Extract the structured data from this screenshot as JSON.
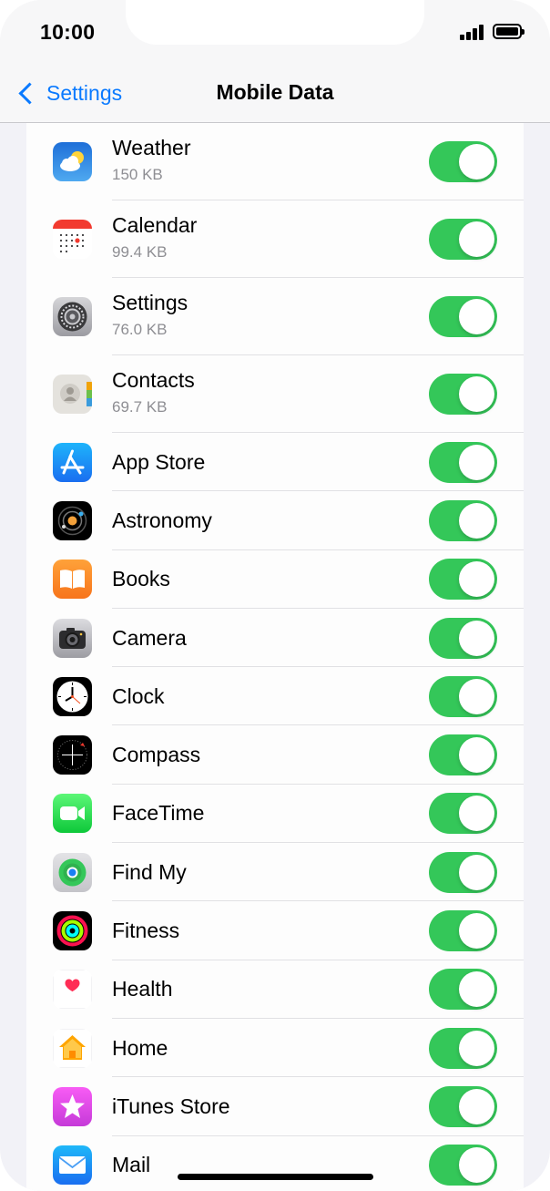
{
  "status_bar": {
    "time": "10:00"
  },
  "nav": {
    "back_label": "Settings",
    "title": "Mobile Data"
  },
  "apps": [
    {
      "name": "Weather",
      "size": "150 KB",
      "icon": "weather-icon",
      "enabled": true
    },
    {
      "name": "Calendar",
      "size": "99.4 KB",
      "icon": "calendar-icon",
      "enabled": true
    },
    {
      "name": "Settings",
      "size": "76.0 KB",
      "icon": "settings-gear-icon",
      "enabled": true
    },
    {
      "name": "Contacts",
      "size": "69.7 KB",
      "icon": "contacts-icon",
      "enabled": true
    },
    {
      "name": "App Store",
      "icon": "app-store-icon",
      "enabled": true
    },
    {
      "name": "Astronomy",
      "icon": "astronomy-icon",
      "enabled": true
    },
    {
      "name": "Books",
      "icon": "books-icon",
      "enabled": true
    },
    {
      "name": "Camera",
      "icon": "camera-icon",
      "enabled": true
    },
    {
      "name": "Clock",
      "icon": "clock-icon",
      "enabled": true
    },
    {
      "name": "Compass",
      "icon": "compass-icon",
      "enabled": true
    },
    {
      "name": "FaceTime",
      "icon": "facetime-icon",
      "enabled": true
    },
    {
      "name": "Find My",
      "icon": "find-my-icon",
      "enabled": true
    },
    {
      "name": "Fitness",
      "icon": "fitness-icon",
      "enabled": true
    },
    {
      "name": "Health",
      "icon": "health-icon",
      "enabled": true
    },
    {
      "name": "Home",
      "icon": "home-icon",
      "enabled": true
    },
    {
      "name": "iTunes Store",
      "icon": "itunes-store-icon",
      "enabled": true
    },
    {
      "name": "Mail",
      "icon": "mail-icon",
      "enabled": true
    }
  ],
  "colors": {
    "accent": "#0a7aff",
    "toggle_on": "#34c759"
  }
}
